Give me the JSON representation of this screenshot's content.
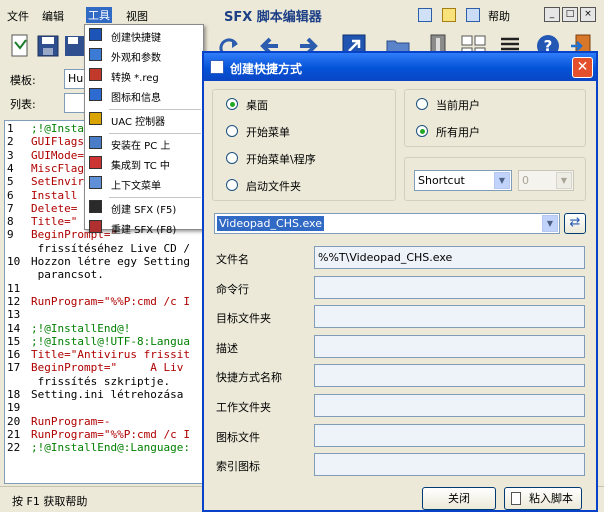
{
  "menubar": {
    "file": "文件",
    "edit": "编辑",
    "tools": "工具",
    "view": "视图",
    "app_title": "SFX 脚本编辑器",
    "help": "帮助"
  },
  "main": {
    "template_label": "模板:",
    "template_value": "Hu",
    "list_label": "列表:"
  },
  "editor": {
    "lines": [
      {
        "n": "1",
        "t": ";!@Install",
        "c": "#008000"
      },
      {
        "n": "2",
        "t": "GUIFlags=",
        "c": "#b00000"
      },
      {
        "n": "3",
        "t": "GUIMode=",
        "c": "#b00000"
      },
      {
        "n": "4",
        "t": "MiscFlag",
        "c": "#b00000"
      },
      {
        "n": "5",
        "t": "SetEnvir",
        "c": "#b00000"
      },
      {
        "n": "6",
        "t": "Install",
        "c": "#b00000"
      },
      {
        "n": "7",
        "t": "Delete=",
        "c": "#b00000"
      },
      {
        "n": "8",
        "t": "Title=\"",
        "c": "#b00000"
      },
      {
        "n": "9",
        "t": "BeginPrompt=\"",
        "c": "#b00000"
      },
      {
        "n": "",
        "t": " frissítéséhez Live CD /",
        "c": "#000000"
      },
      {
        "n": "10",
        "t": "Hozzon létre egy Setting",
        "c": "#000000"
      },
      {
        "n": "",
        "t": " parancsot.",
        "c": "#000000"
      },
      {
        "n": "11",
        "t": "",
        "c": "#000000"
      },
      {
        "n": "12",
        "t": "RunProgram=\"%%P:cmd /c I",
        "c": "#b00000"
      },
      {
        "n": "13",
        "t": "",
        "c": "#000000"
      },
      {
        "n": "14",
        "t": ";!@InstallEnd@!",
        "c": "#008000"
      },
      {
        "n": "15",
        "t": ";!@Install@!UTF-8:Langua",
        "c": "#008000"
      },
      {
        "n": "16",
        "t": "Title=\"Antivirus frissit",
        "c": "#b00000"
      },
      {
        "n": "17",
        "t": "BeginPrompt=\"     A Liv",
        "c": "#b00000"
      },
      {
        "n": "",
        "t": " frissítés szkriptje.",
        "c": "#000000"
      },
      {
        "n": "18",
        "t": "Setting.ini létrehozása",
        "c": "#000000"
      },
      {
        "n": "19",
        "t": "",
        "c": "#000000"
      },
      {
        "n": "20",
        "t": "RunProgram=-",
        "c": "#b00000"
      },
      {
        "n": "21",
        "t": "RunProgram=\"%%P:cmd /c I",
        "c": "#b00000"
      },
      {
        "n": "22",
        "t": ";!@InstallEnd@:Language:",
        "c": "#008000"
      }
    ]
  },
  "status": {
    "text": "按 F1 获取帮助"
  },
  "tools_menu": {
    "items": [
      {
        "label": "创建快捷键",
        "icon": "shortcut-icon"
      },
      {
        "label": "外观和参数",
        "icon": "appearance-icon"
      },
      {
        "label": "转换 *.reg",
        "icon": "reg-convert-icon"
      },
      {
        "label": "图标和信息",
        "icon": "icon-info-icon"
      },
      {
        "label": "UAC 控制器",
        "icon": "uac-shield-icon"
      },
      {
        "label": "安装在 PC 上",
        "icon": "install-pc-icon"
      },
      {
        "label": "集成到 TC 中",
        "icon": "integrate-tc-icon"
      },
      {
        "label": "上下文菜单",
        "icon": "context-menu-icon"
      },
      {
        "label": "创建 SFX (F5)",
        "icon": "create-sfx-icon"
      },
      {
        "label": "重建 SFX (F8)",
        "icon": "rebuild-sfx-icon"
      }
    ]
  },
  "dialog": {
    "title": "创建快捷方式",
    "locations": [
      "桌面",
      "开始菜单",
      "开始菜单\\程序",
      "启动文件夹"
    ],
    "location_selected": 0,
    "users": [
      "当前用户",
      "所有用户"
    ],
    "user_selected": 1,
    "type_select": "Shortcut",
    "index_select": "0",
    "file_combo": "Videopad_CHS.exe",
    "fields": [
      {
        "label": "文件名",
        "value": "%%T\\Videopad_CHS.exe"
      },
      {
        "label": "命令行",
        "value": ""
      },
      {
        "label": "目标文件夹",
        "value": ""
      },
      {
        "label": "描述",
        "value": ""
      },
      {
        "label": "快捷方式名称",
        "value": ""
      },
      {
        "label": "工作文件夹",
        "value": ""
      },
      {
        "label": "图标文件",
        "value": ""
      },
      {
        "label": "索引图标",
        "value": ""
      }
    ],
    "close_button": "关闭",
    "paste_button": "粘入脚本"
  },
  "colors": {
    "accent": "#0842c8",
    "selection": "#316ac5",
    "titlebar": "#0452d6"
  }
}
